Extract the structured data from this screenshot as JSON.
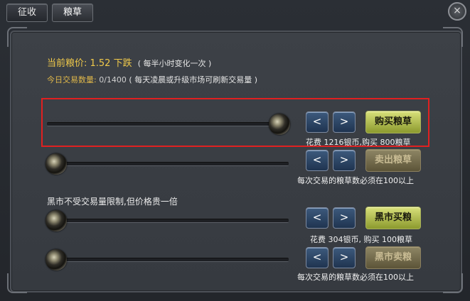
{
  "tabs": [
    {
      "label": "征收",
      "active": false
    },
    {
      "label": "粮草",
      "active": true
    }
  ],
  "close_icon": "×",
  "price": {
    "label": "当前粮价: 1.52",
    "trend": "下跌",
    "note": "( 每半小时变化一次 )"
  },
  "trade": {
    "label": "今日交易数量:",
    "count": "0/1400",
    "note": "( 每天凌晨或升级市场可刷新交易量 )"
  },
  "rows": {
    "buy": {
      "slider_fraction": 1.0,
      "prev_label": "<",
      "next_label": ">",
      "action_label": "购买粮草",
      "info": "花费  1216银币,购买  800粮草"
    },
    "sell": {
      "slider_fraction": 0.0,
      "prev_label": "<",
      "next_label": ">",
      "action_label": "卖出粮草",
      "info": "每次交易的粮草数必须在100以上"
    },
    "black_buy": {
      "slider_fraction": 0.0,
      "prev_label": "<",
      "next_label": ">",
      "action_label": "黑市买粮",
      "info": "花费  304银币, 购买  100粮草"
    },
    "black_sell": {
      "slider_fraction": 0.0,
      "prev_label": "<",
      "next_label": ">",
      "action_label": "黑市卖粮",
      "info": "每次交易的粮草数必须在100以上"
    }
  },
  "black_market_note": "黑市不受交易量限制,但价格贵一倍",
  "colors": {
    "price_gold": "#f0c94a",
    "action_green": "#c9d263",
    "highlight_red": "#e02020"
  }
}
